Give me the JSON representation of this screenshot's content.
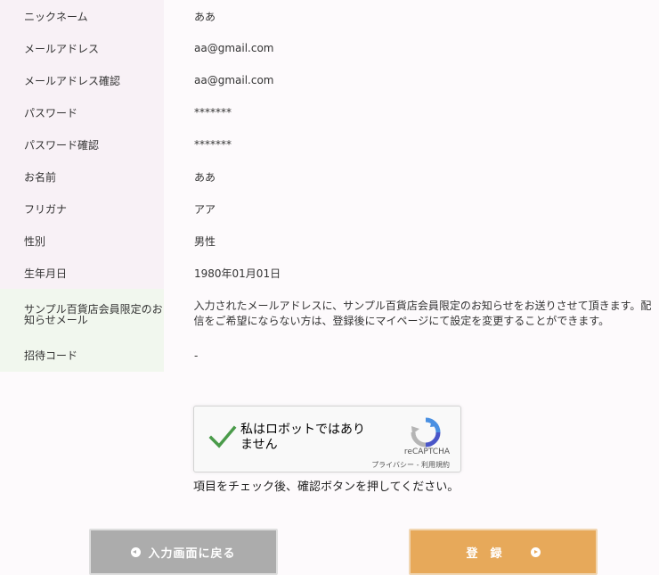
{
  "rows": [
    {
      "label": "ニックネーム",
      "value": "ああ"
    },
    {
      "label": "メールアドレス",
      "value": "aa@gmail.com"
    },
    {
      "label": "メールアドレス確認",
      "value": "aa@gmail.com"
    },
    {
      "label": "パスワード",
      "value": "*******"
    },
    {
      "label": "パスワード確認",
      "value": "*******"
    },
    {
      "label": "お名前",
      "value": "ああ"
    },
    {
      "label": "フリガナ",
      "value": "アア"
    },
    {
      "label": "性別",
      "value": "男性"
    },
    {
      "label": "生年月日",
      "value": "1980年01月01日"
    }
  ],
  "mail_row": {
    "label": "サンプル百貨店会員限定のお知らせメール",
    "value": "入力されたメールアドレスに、サンプル百貨店会員限定のお知らせをお送りさせて頂きます。配信をご希望にならない方は、登録後にマイページにて設定を変更することができます。"
  },
  "invite_row": {
    "label": "招待コード",
    "value": "-"
  },
  "recaptcha": {
    "text": "私はロボットではありません",
    "brand": "reCAPTCHA",
    "links": "プライバシー - 利用規約",
    "check_color": "#4a9b4a"
  },
  "note": "項目をチェック後、確認ボタンを押してください。",
  "buttons": {
    "back": "入力画面に戻る",
    "submit": "登録"
  }
}
